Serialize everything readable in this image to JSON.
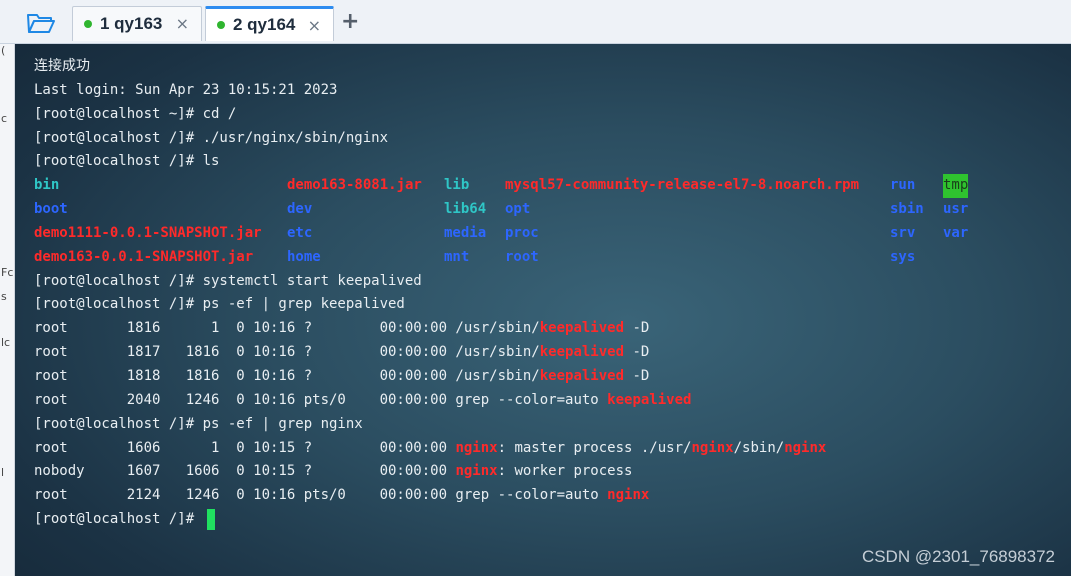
{
  "tabs": [
    {
      "label": "1 qy163",
      "active": false,
      "status_color": "#2fb52f"
    },
    {
      "label": "2 qy164",
      "active": true,
      "status_color": "#2fb52f"
    }
  ],
  "tab_close_glyph": "×",
  "new_tab_glyph": "+",
  "sliver_text": [
    "(",
    "c",
    "Fc",
    "s",
    "lc",
    "l"
  ],
  "terminal": {
    "line1": "连接成功",
    "line2": "Last login: Sun Apr 23 10:15:21 2023",
    "cmd_cd": "[root@localhost ~]# cd /",
    "cmd_nginx": "[root@localhost /]# ./usr/nginx/sbin/nginx",
    "cmd_ls": "[root@localhost /]# ls",
    "ls": [
      [
        "bin",
        "demo163-8081.jar",
        "lib",
        "mysql57-community-release-el7-8.noarch.rpm",
        "run",
        "tmp"
      ],
      [
        "boot",
        "dev",
        "lib64",
        "opt",
        "sbin",
        "usr"
      ],
      [
        "demo1111-0.0.1-SNAPSHOT.jar",
        "etc",
        "media",
        "proc",
        "srv",
        "var"
      ],
      [
        "demo163-0.0.1-SNAPSHOT.jar",
        "home",
        "mnt",
        "root",
        "sys",
        ""
      ]
    ],
    "cmd_keep": "[root@localhost /]# systemctl start keepalived",
    "cmd_grep_keep": "[root@localhost /]# ps -ef | grep keepalived",
    "ps_keep": [
      {
        "prefix": "root       1816      1  0 10:16 ?        00:00:00 /usr/sbin/",
        "hl": "keepalived",
        "suffix": " -D"
      },
      {
        "prefix": "root       1817   1816  0 10:16 ?        00:00:00 /usr/sbin/",
        "hl": "keepalived",
        "suffix": " -D"
      },
      {
        "prefix": "root       1818   1816  0 10:16 ?        00:00:00 /usr/sbin/",
        "hl": "keepalived",
        "suffix": " -D"
      },
      {
        "prefix": "root       2040   1246  0 10:16 pts/0    00:00:00 grep --color=auto ",
        "hl": "keepalived",
        "suffix": ""
      }
    ],
    "cmd_grep_nginx": "[root@localhost /]# ps -ef | grep nginx",
    "ps_nginx_1": {
      "prefix": "root       1606      1  0 10:15 ?        00:00:00 ",
      "hl1": "nginx",
      "mid1": ": master process ./usr/",
      "hl2": "nginx",
      "mid2": "/sbin/",
      "hl3": "nginx"
    },
    "ps_nginx_2": {
      "prefix": "nobody     1607   1606  0 10:15 ?        00:00:00 ",
      "hl": "nginx",
      "suffix": ": worker process"
    },
    "ps_nginx_3": {
      "prefix": "root       2124   1246  0 10:16 pts/0    00:00:00 grep --color=auto ",
      "hl": "nginx",
      "suffix": ""
    },
    "prompt": "[root@localhost /]# "
  },
  "watermark": "CSDN @2301_76898372",
  "colors": {
    "highlight_red": "#ff2a2a",
    "dir_blue": "#2d66ff",
    "link_cyan": "#2fc6c6",
    "tmp_bg_green": "#2fc32f",
    "cursor_green": "#20e060"
  }
}
